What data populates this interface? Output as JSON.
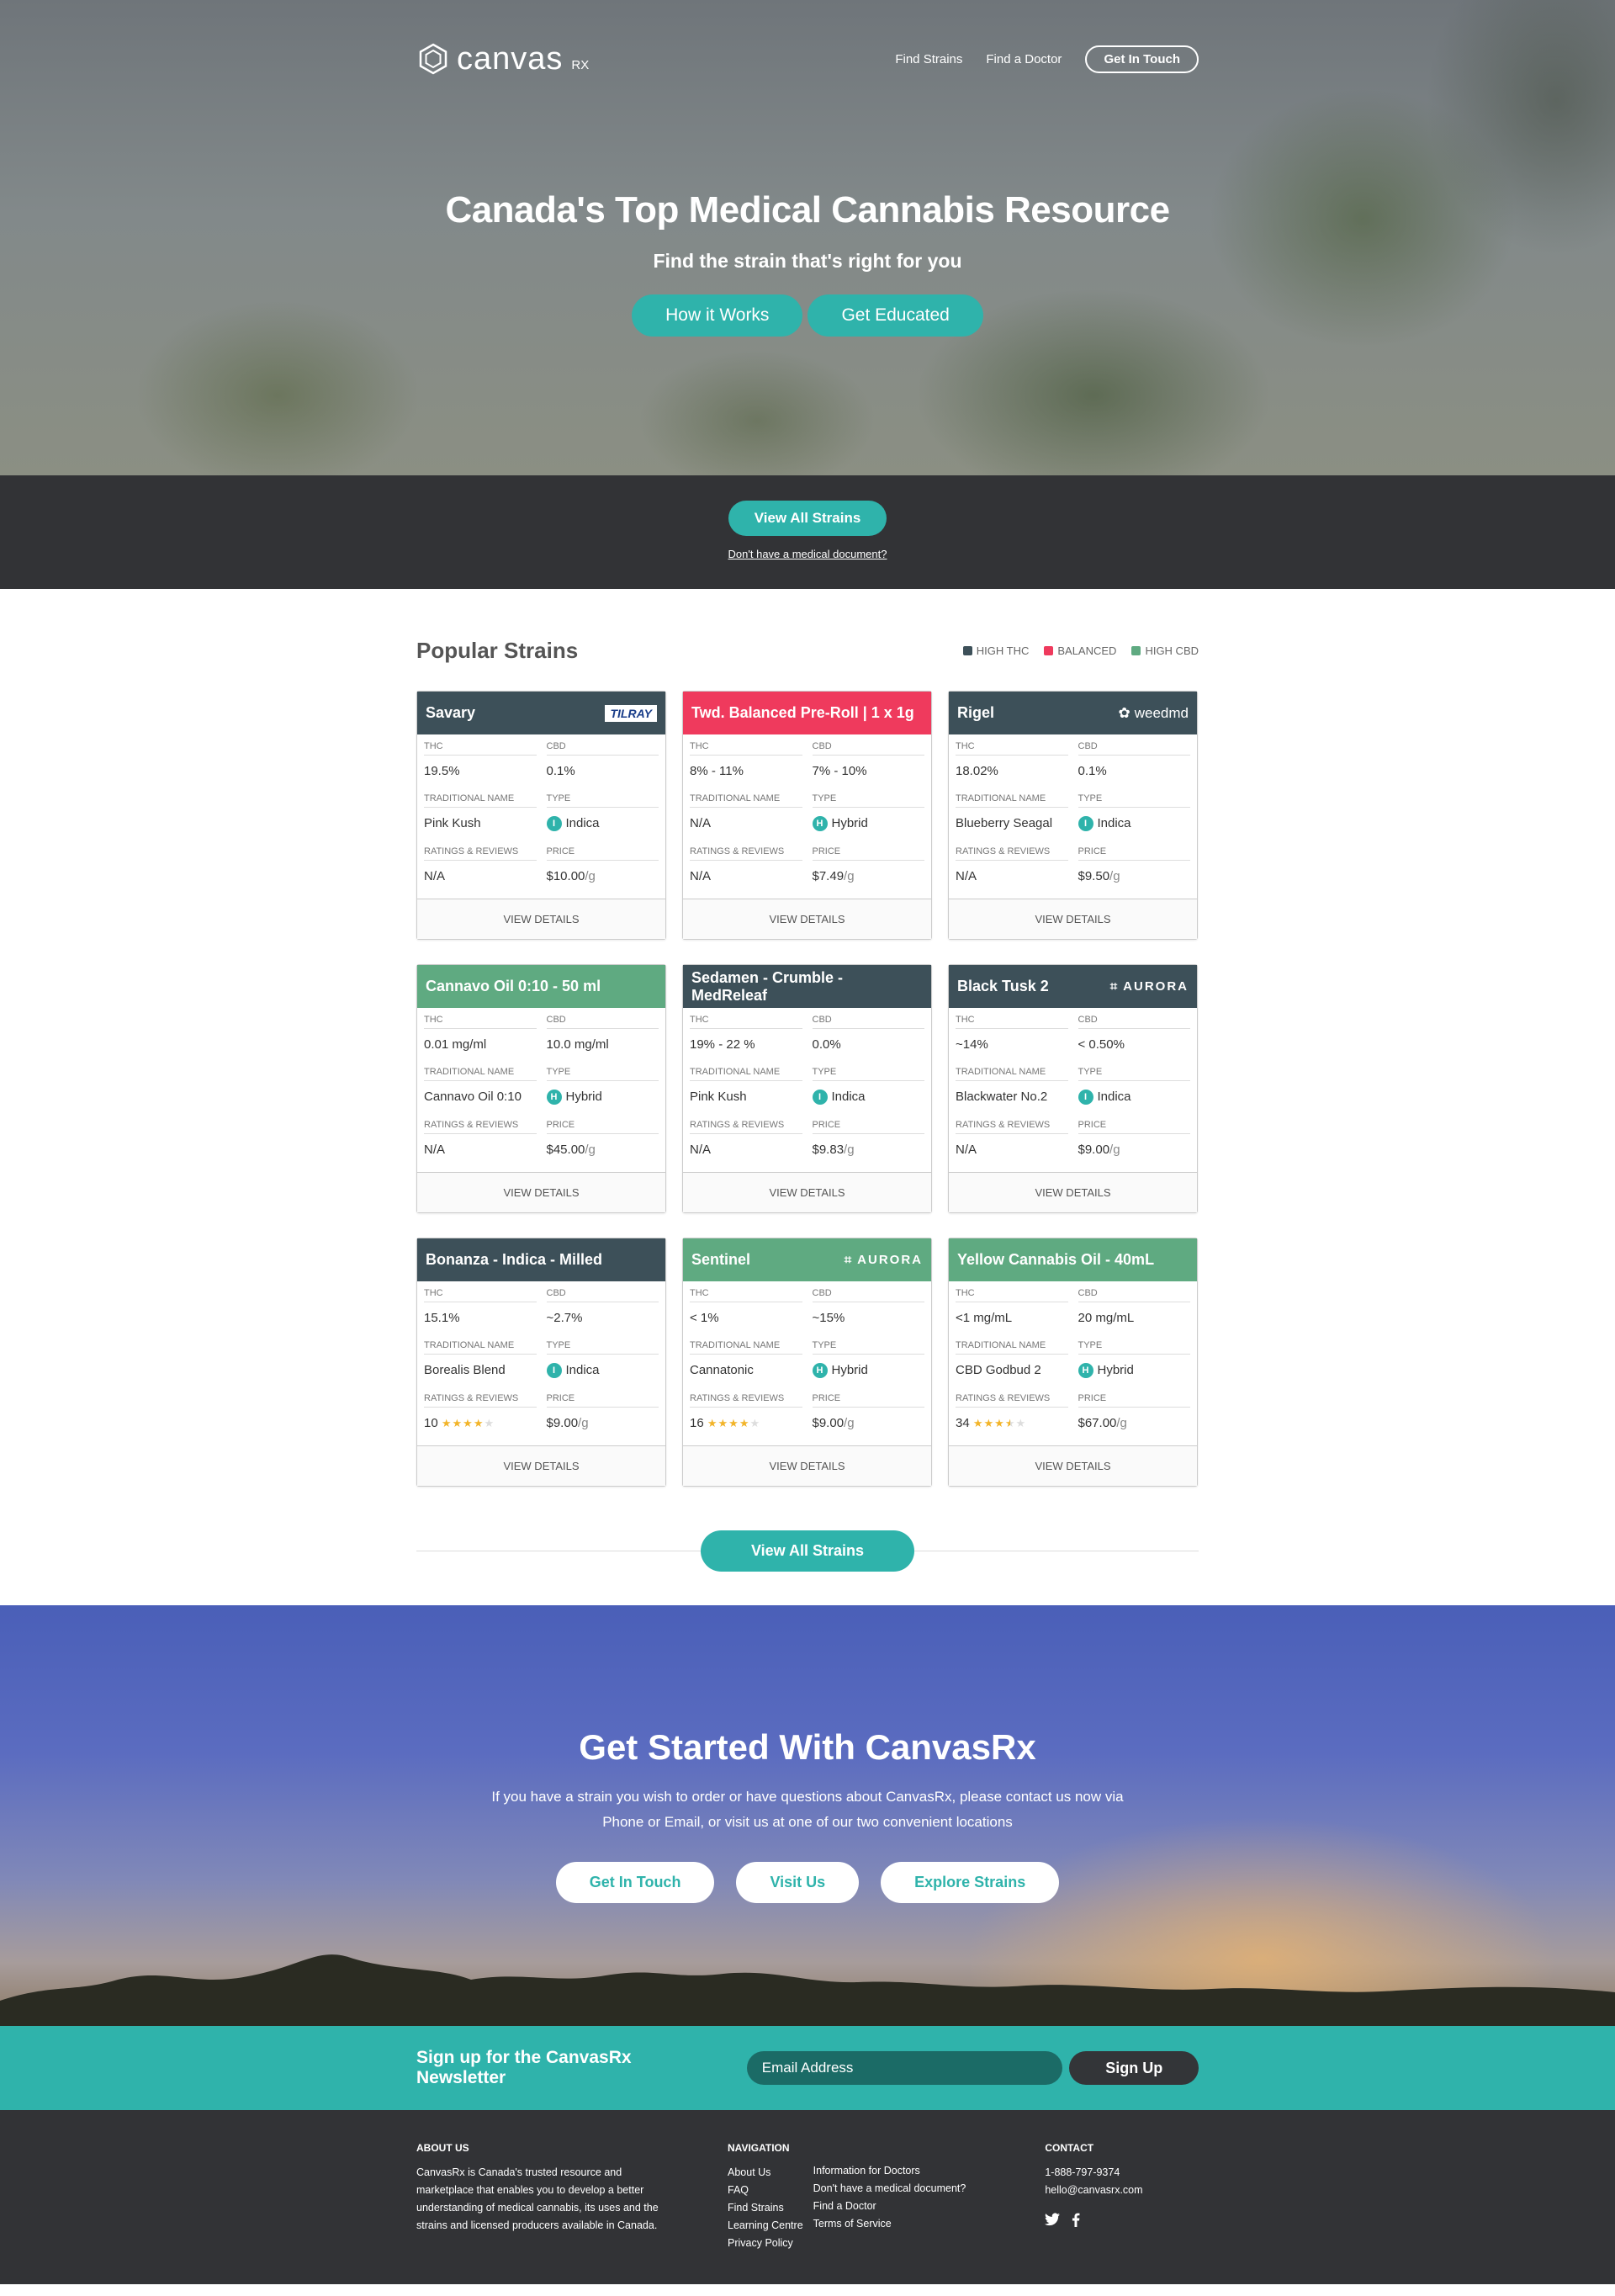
{
  "header": {
    "logo_text": "canvas",
    "logo_sub": "RX",
    "nav": [
      "Find Strains",
      "Find a Doctor"
    ],
    "cta": "Get In Touch"
  },
  "hero": {
    "title": "Canada's Top Medical Cannabis Resource",
    "subtitle": "Find the strain that's right for you",
    "buttons": [
      "How it Works",
      "Get Educated"
    ],
    "view_all": "View All Strains",
    "doc_link": "Don't have a medical document?"
  },
  "strains": {
    "title": "Popular Strains",
    "legend": [
      {
        "label": "HIGH THC",
        "color": "#3d5059"
      },
      {
        "label": "BALANCED",
        "color": "#ef3a5d"
      },
      {
        "label": "HIGH CBD",
        "color": "#5faa81"
      }
    ],
    "labels": {
      "thc": "THC",
      "cbd": "CBD",
      "trad": "TRADITIONAL NAME",
      "type": "TYPE",
      "ratings": "RATINGS & REVIEWS",
      "price": "PRICE",
      "details": "VIEW DETAILS",
      "per_g": "/g"
    },
    "cards": [
      {
        "name": "Savary",
        "cat": "thc",
        "brand": "TILRAY",
        "thc": "19.5%",
        "cbd": "0.1%",
        "trad": "Pink Kush",
        "type": "Indica",
        "type_icon": "I",
        "rating": "N/A",
        "stars": 0,
        "price": "$10.00",
        "per_g": true
      },
      {
        "name": "Twd. Balanced Pre-Roll | 1 x 1g",
        "cat": "bal",
        "brand": "",
        "thc": "8% - 11%",
        "cbd": "7% - 10%",
        "trad": "N/A",
        "type": "Hybrid",
        "type_icon": "H",
        "rating": "N/A",
        "stars": 0,
        "price": "$7.49",
        "per_g": true
      },
      {
        "name": "Rigel",
        "cat": "thc",
        "brand": "weedmd",
        "thc": "18.02%",
        "cbd": "0.1%",
        "trad": "Blueberry Seagal",
        "type": "Indica",
        "type_icon": "I",
        "rating": "N/A",
        "stars": 0,
        "price": "$9.50",
        "per_g": true
      },
      {
        "name": "Cannavo Oil 0:10 - 50 ml",
        "cat": "cbd",
        "brand": "",
        "thc": "0.01 mg/ml",
        "cbd": "10.0 mg/ml",
        "trad": "Cannavo Oil 0:10",
        "type": "Hybrid",
        "type_icon": "H",
        "rating": "N/A",
        "stars": 0,
        "price": "$45.00",
        "per_g": true
      },
      {
        "name": "Sedamen - Crumble - MedReleaf",
        "cat": "thc",
        "brand": "",
        "thc": "19% - 22 %",
        "cbd": "0.0%",
        "trad": "Pink Kush",
        "type": "Indica",
        "type_icon": "I",
        "rating": "N/A",
        "stars": 0,
        "price": "$9.83",
        "per_g": true
      },
      {
        "name": "Black Tusk 2",
        "cat": "thc",
        "brand": "AURORA",
        "thc": "~14%",
        "cbd": "< 0.50%",
        "trad": "Blackwater No.2",
        "type": "Indica",
        "type_icon": "I",
        "rating": "N/A",
        "stars": 0,
        "price": "$9.00",
        "per_g": true
      },
      {
        "name": "Bonanza - Indica - Milled",
        "cat": "thc",
        "brand": "",
        "thc": "15.1%",
        "cbd": "~2.7%",
        "trad": "Borealis Blend",
        "type": "Indica",
        "type_icon": "I",
        "rating": "10",
        "stars": 4,
        "price": "$9.00",
        "per_g": true
      },
      {
        "name": "Sentinel",
        "cat": "cbd",
        "brand": "AURORA",
        "thc": "< 1%",
        "cbd": "~15%",
        "trad": "Cannatonic",
        "type": "Hybrid",
        "type_icon": "H",
        "rating": "16",
        "stars": 4,
        "price": "$9.00",
        "per_g": true
      },
      {
        "name": "Yellow Cannabis Oil - 40mL",
        "cat": "cbd",
        "brand": "",
        "thc": "<1 mg/mL",
        "cbd": "20 mg/mL",
        "trad": "CBD Godbud 2",
        "type": "Hybrid",
        "type_icon": "H",
        "rating": "34",
        "stars": 3.5,
        "price": "$67.00",
        "per_g": true
      }
    ],
    "view_all": "View All Strains"
  },
  "started": {
    "title": "Get Started With CanvasRx",
    "text": "If you have a strain you wish to order or have questions about CanvasRx, please contact us now via Phone or Email, or visit us at one of our two convenient locations",
    "buttons": [
      "Get In Touch",
      "Visit Us",
      "Explore Strains"
    ]
  },
  "newsletter": {
    "title": "Sign up for the CanvasRx Newsletter",
    "placeholder": "Email Address",
    "button": "Sign Up"
  },
  "footer": {
    "about_title": "ABOUT US",
    "about_text": "CanvasRx is Canada's trusted resource and marketplace that enables you to develop a better understanding of medical cannabis, its uses and the strains and licensed producers available in Canada.",
    "nav_title": "NAVIGATION",
    "nav1": [
      "About Us",
      "FAQ",
      "Find Strains",
      "Learning Centre",
      "Privacy Policy"
    ],
    "nav2": [
      "Information for Doctors",
      "Don't have a medical document?",
      "Find a Doctor",
      "Terms of Service"
    ],
    "contact_title": "CONTACT",
    "phone": "1-888-797-9374",
    "email": "hello@canvasrx.com",
    "social": [
      "twitter-icon",
      "facebook-icon"
    ]
  }
}
